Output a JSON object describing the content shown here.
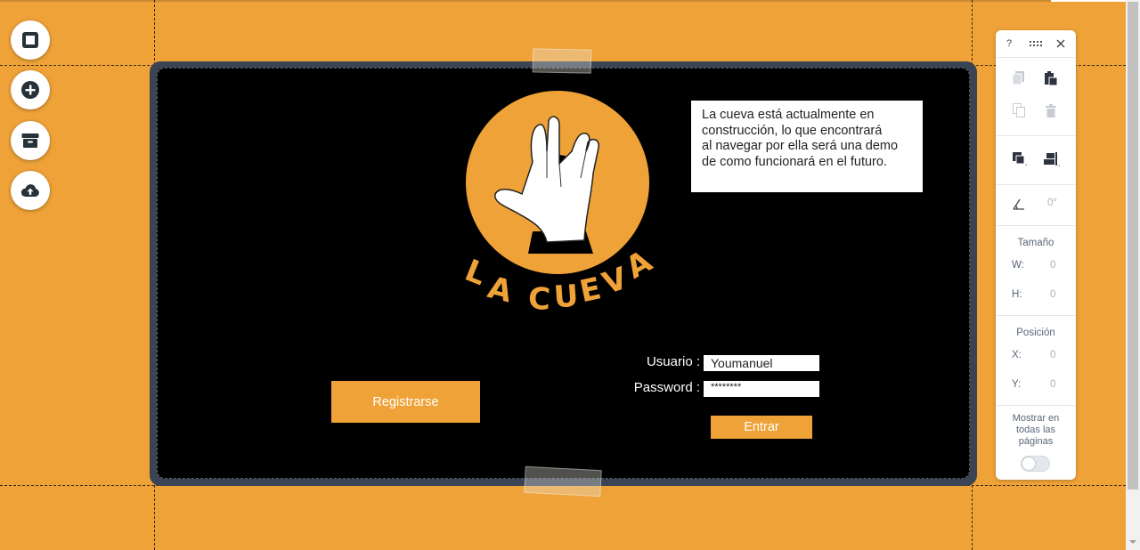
{
  "tools": [
    {
      "name": "rectangle-tool",
      "icon": "square-icon"
    },
    {
      "name": "add-tool",
      "icon": "plus-circle-icon"
    },
    {
      "name": "archive-tool",
      "icon": "archive-box-icon"
    },
    {
      "name": "upload-tool",
      "icon": "cloud-upload-icon"
    }
  ],
  "canvas": {
    "notice": " La cueva está actualmente en\nconstrucción, lo que encontrará\nal navegar por ella será una demo\nde como funcionará en el futuro.",
    "logo_text": "LA CUEVA",
    "login": {
      "user_label": "Usuario :",
      "user_value": "Youmanuel",
      "password_label": "Password :",
      "password_value": "********",
      "submit_label": "Entrar"
    },
    "register_label": "Registrarse"
  },
  "panel": {
    "help": "?",
    "rotation_value": "0°",
    "size_title": "Tamaño",
    "w_label": "W:",
    "w_value": "0",
    "h_label": "H:",
    "h_value": "0",
    "position_title": "Posición",
    "x_label": "X:",
    "x_value": "0",
    "y_label": "Y:",
    "y_value": "0",
    "show_all_label": "Mostrar en\ntodas las\npáginas",
    "show_all_on": false
  },
  "colors": {
    "background": "#EFA238",
    "canvas": "#000000",
    "frame": "#3b4455",
    "accent": "#EFA238"
  }
}
